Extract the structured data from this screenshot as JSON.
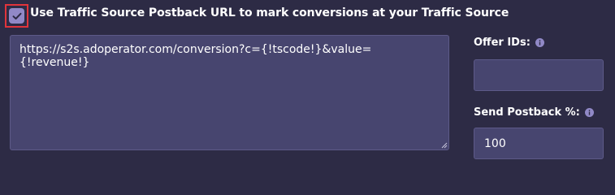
{
  "postback": {
    "checkbox_checked": true,
    "checkbox_label": "Use Traffic Source Postback URL to mark conversions at your Traffic Source",
    "url_value": "https://s2s.adoperator.com/conversion?c={!tscode!}&value={!revenue!}"
  },
  "offer_ids": {
    "label": "Offer IDs:",
    "value": "",
    "info_icon": "info-icon"
  },
  "send_postback": {
    "label": "Send Postback %:",
    "value": "100",
    "info_icon": "info-icon"
  },
  "colors": {
    "background": "#2d2b45",
    "field_background": "#47456f",
    "accent": "#9189c7",
    "highlight_border": "#e0343c"
  }
}
